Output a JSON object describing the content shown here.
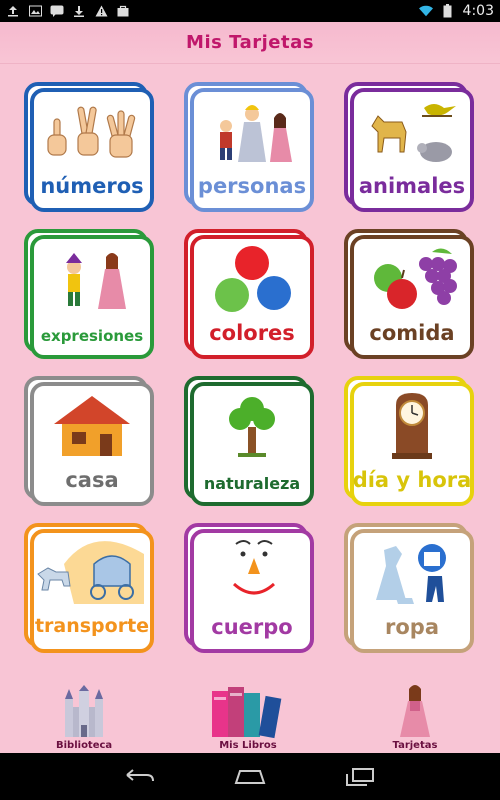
{
  "status_bar": {
    "time": "4:03",
    "icons": [
      "upload-icon",
      "image-icon",
      "talk-icon",
      "download-icon",
      "warning-icon",
      "bag-icon"
    ]
  },
  "app": {
    "title": "Mis Tarjetas"
  },
  "cards": [
    {
      "label": "números",
      "color": "#1f5fb4",
      "icon": "hands-counting-icon"
    },
    {
      "label": "personas",
      "color": "#6b8fd6",
      "icon": "people-icon"
    },
    {
      "label": "animales",
      "color": "#7a2c9c",
      "icon": "animals-icon"
    },
    {
      "label": "expresiones",
      "color": "#2a9a3a",
      "icon": "expressions-icon"
    },
    {
      "label": "colores",
      "color": "#d21f2a",
      "icon": "color-dots-icon"
    },
    {
      "label": "comida",
      "color": "#6b4124",
      "icon": "fruit-icon"
    },
    {
      "label": "casa",
      "color": "#8c8c8c",
      "icon": "house-icon"
    },
    {
      "label": "naturaleza",
      "color": "#1e6b2f",
      "icon": "tree-icon"
    },
    {
      "label": "día y hora",
      "color": "#e7d20e",
      "icon": "clock-icon"
    },
    {
      "label": "transporte",
      "color": "#f3931d",
      "icon": "carriage-icon"
    },
    {
      "label": "cuerpo",
      "color": "#a23aa3",
      "icon": "face-icon"
    },
    {
      "label": "ropa",
      "color": "#c5a27a",
      "icon": "clothes-icon"
    }
  ],
  "bottom_nav": {
    "biblioteca": "Biblioteca",
    "mis_libros": "Mis Libros",
    "tarjetas": "Tarjetas"
  }
}
